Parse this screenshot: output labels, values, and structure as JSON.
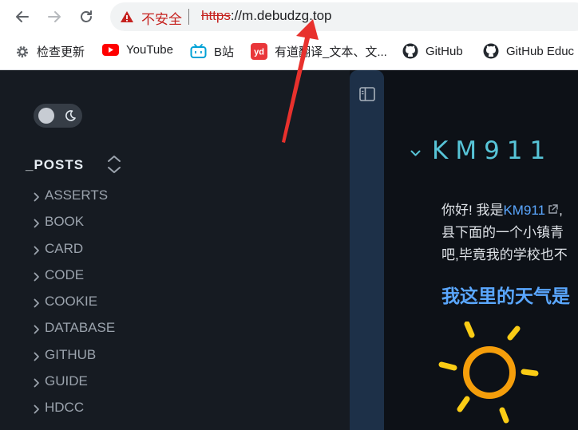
{
  "browser": {
    "security_label": "不安全",
    "url_scheme": "https",
    "url_rest": "://m.debudzg.top"
  },
  "bookmarks": [
    {
      "label": "检查更新",
      "icon": "gear-icon"
    },
    {
      "label": "YouTube",
      "icon": "youtube-icon"
    },
    {
      "label": "B站",
      "icon": "bilibili-icon"
    },
    {
      "label": "有道翻译_文本、文...",
      "icon": "youdao-icon",
      "badge": "yd"
    },
    {
      "label": "GitHub",
      "icon": "github-icon"
    },
    {
      "label": "GitHub Educ",
      "icon": "github-icon"
    }
  ],
  "sidebar": {
    "section_title": "_POSTS",
    "items": [
      "ASSERTS",
      "BOOK",
      "CARD",
      "CODE",
      "COOKIE",
      "DATABASE",
      "GITHUB",
      "GUIDE",
      "HDCC"
    ]
  },
  "main": {
    "heading": "KM911",
    "para_line1_prefix": "你好! 我是",
    "para_link": "KM911",
    "para_line1_suffix": ",",
    "para_line2": "县下面的一个小镇青",
    "para_line3": "吧,毕竟我的学校也不",
    "weather_heading": "我这里的天气是"
  },
  "colors": {
    "accent_title": "#57c4d7",
    "link": "#5aa7ff",
    "sun": "#f59e0b",
    "sun_rays": "#facc15",
    "annotation_arrow": "#e8312d"
  }
}
